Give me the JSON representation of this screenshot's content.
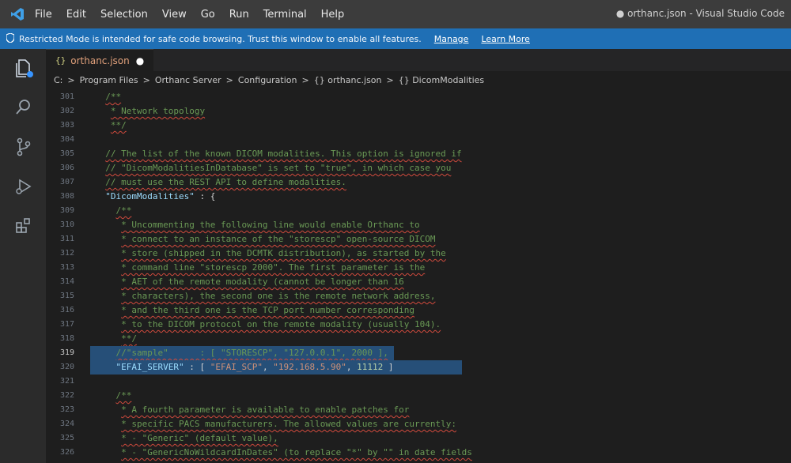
{
  "titlebar": {
    "menu": [
      "File",
      "Edit",
      "Selection",
      "View",
      "Go",
      "Run",
      "Terminal",
      "Help"
    ],
    "window_title": "● orthanc.json - Visual Studio Code"
  },
  "banner": {
    "message": "Restricted Mode is intended for safe code browsing. Trust this window to enable all features.",
    "manage_label": "Manage",
    "learn_more_label": "Learn More"
  },
  "tab": {
    "name": "orthanc.json"
  },
  "breadcrumb": [
    "C:",
    ">",
    "Program Files",
    ">",
    "Orthanc Server",
    ">",
    "Configuration",
    ">",
    "{} orthanc.json",
    ">",
    "{} DicomModalities"
  ],
  "icons": [
    "vscode-logo-icon",
    "shield-icon",
    "explorer-icon",
    "search-icon",
    "source-control-icon",
    "run-debug-icon",
    "extensions-icon"
  ],
  "colors": {
    "comment": "#6a9955",
    "string": "#ce9178",
    "key": "#9cdcfe",
    "selection": "#264f78",
    "banner": "#1f6fb5"
  },
  "lines": [
    {
      "n": "301",
      "indent": "  ",
      "text": "/**",
      "kind": "comment"
    },
    {
      "n": "302",
      "indent": "   ",
      "text": "* Network topology",
      "kind": "comment"
    },
    {
      "n": "303",
      "indent": "   ",
      "text": "**/",
      "kind": "comment"
    },
    {
      "n": "304",
      "indent": "",
      "text": "",
      "kind": "plain"
    },
    {
      "n": "305",
      "indent": "  ",
      "text": "// The list of the known DICOM modalities. This option is ignored if",
      "kind": "comment"
    },
    {
      "n": "306",
      "indent": "  ",
      "text": "// \"DicomModalitiesInDatabase\" is set to \"true\", in which case you",
      "kind": "comment"
    },
    {
      "n": "307",
      "indent": "  ",
      "text": "// must use the REST API to define modalities.",
      "kind": "comment"
    },
    {
      "n": "308",
      "indent": "  ",
      "key": "\"DicomModalities\"",
      "rest": " : {",
      "kind": "keyline"
    },
    {
      "n": "309",
      "indent": "    ",
      "text": "/**",
      "kind": "comment"
    },
    {
      "n": "310",
      "indent": "     ",
      "text": "* Uncommenting the following line would enable Orthanc to",
      "kind": "comment"
    },
    {
      "n": "311",
      "indent": "     ",
      "text": "* connect to an instance of the \"storescp\" open-source DICOM",
      "kind": "comment"
    },
    {
      "n": "312",
      "indent": "     ",
      "text": "* store (shipped in the DCMTK distribution), as started by the",
      "kind": "comment"
    },
    {
      "n": "313",
      "indent": "     ",
      "text": "* command line \"storescp 2000\". The first parameter is the",
      "kind": "comment"
    },
    {
      "n": "314",
      "indent": "     ",
      "text": "* AET of the remote modality (cannot be longer than 16",
      "kind": "comment"
    },
    {
      "n": "315",
      "indent": "     ",
      "text": "* characters), the second one is the remote network address,",
      "kind": "comment"
    },
    {
      "n": "316",
      "indent": "     ",
      "text": "* and the third one is the TCP port number corresponding",
      "kind": "comment"
    },
    {
      "n": "317",
      "indent": "     ",
      "text": "* to the DICOM protocol on the remote modality (usually 104).",
      "kind": "comment"
    },
    {
      "n": "318",
      "indent": "     ",
      "text": "**/",
      "kind": "comment"
    },
    {
      "n": "319",
      "indent": "    ",
      "text": "//\"sample\"      : [ \"STORESCP\", \"127.0.0.1\", 2000 ],",
      "kind": "selcomment"
    },
    {
      "n": "320",
      "indent": "    ",
      "key": "\"EFAI_SERVER\"",
      "sep": " : [ ",
      "s1": "\"EFAI_SCP\"",
      "c1": ", ",
      "s2": "\"192.168.5.90\"",
      "c2": ", ",
      "num": "11112",
      "end": " ]",
      "kind": "selentry"
    },
    {
      "n": "321",
      "indent": "",
      "text": "",
      "kind": "plain"
    },
    {
      "n": "322",
      "indent": "    ",
      "text": "/**",
      "kind": "comment"
    },
    {
      "n": "323",
      "indent": "     ",
      "text": "* A fourth parameter is available to enable patches for",
      "kind": "comment"
    },
    {
      "n": "324",
      "indent": "     ",
      "text": "* specific PACS manufacturers. The allowed values are currently:",
      "kind": "comment"
    },
    {
      "n": "325",
      "indent": "     ",
      "text": "* - \"Generic\" (default value),",
      "kind": "comment"
    },
    {
      "n": "326",
      "indent": "     ",
      "text": "* - \"GenericNoWildcardInDates\" (to replace \"*\" by \"\" in date fields",
      "kind": "comment"
    }
  ]
}
